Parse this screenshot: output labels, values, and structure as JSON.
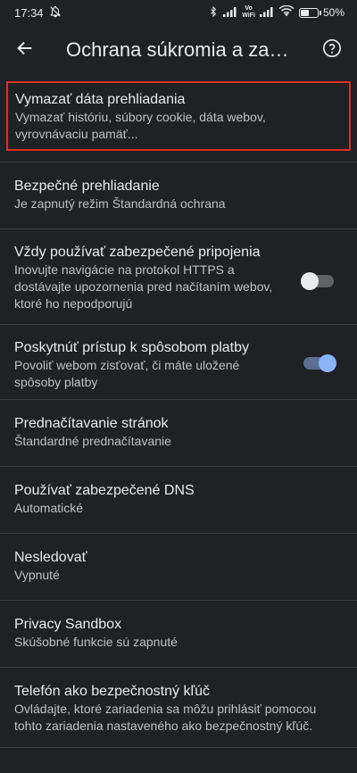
{
  "status_bar": {
    "time": "17:34",
    "vowifi_top": "Vo",
    "vowifi_bottom": "WiFi",
    "battery_percent_label": "50%",
    "battery_level": 0.5
  },
  "app_bar": {
    "title": "Ochrana súkromia a zabe..."
  },
  "items": [
    {
      "title": "Vymazať dáta prehliadania",
      "summary": "Vymazať históriu, súbory cookie, dáta webov, vyrovnávaciu pamäť..."
    },
    {
      "title": "Bezpečné prehliadanie",
      "summary": "Je zapnutý režim Štandardná ochrana"
    },
    {
      "title": "Vždy používať zabezpečené pripojenia",
      "summary": "Inovujte navigácie na protokol HTTPS a dostávajte upozornenia pred načítaním webov, ktoré ho nepodporujú",
      "toggle": "off"
    },
    {
      "title": "Poskytnúť prístup k spôsobom platby",
      "summary": "Povoliť webom zisťovať, či máte uložené spôsoby platby",
      "toggle": "on"
    },
    {
      "title": "Prednačítavanie stránok",
      "summary": "Štandardné prednačítavanie"
    },
    {
      "title": "Používať zabezpečené DNS",
      "summary": "Automatické"
    },
    {
      "title": "Nesledovať",
      "summary": "Vypnuté"
    },
    {
      "title": "Privacy Sandbox",
      "summary": "Skúšobné funkcie sú zapnuté"
    },
    {
      "title": "Telefón ako bezpečnostný kľúč",
      "summary": "Ovládajte, ktoré zariadenia sa môžu prihlásiť pomocou tohto zariadenia nastaveného ako bezpečnostný kľúč."
    }
  ],
  "colors": {
    "background": "#202124",
    "highlight_border": "#d93025",
    "toggle_on_knob": "#8ab4f8"
  }
}
